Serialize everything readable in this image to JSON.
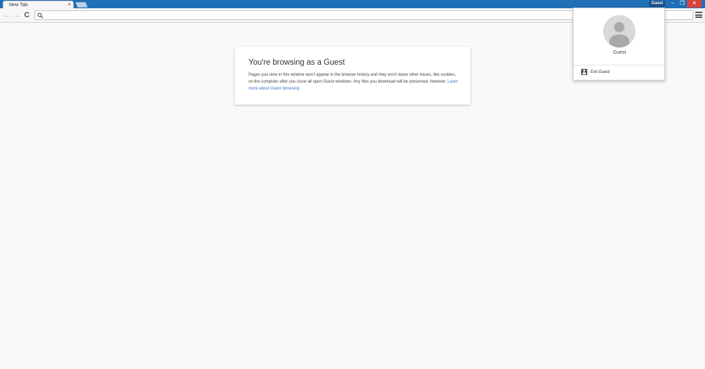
{
  "window": {
    "tab_title": "New Tab",
    "tab_close_glyph": "×",
    "profile_badge": "Guest",
    "minimize_glyph": "–",
    "maximize_glyph": "❐",
    "close_glyph": "✕",
    "accent_color": "#1f6fb6"
  },
  "toolbar": {
    "back_glyph": "←",
    "forward_glyph": "→",
    "reload_glyph": "C",
    "omnibox_value": "",
    "icons": [
      "back-arrow-icon",
      "forward-arrow-icon",
      "reload-icon",
      "search-icon",
      "hamburger-menu-icon"
    ]
  },
  "guest_card": {
    "title": "You're browsing as a Guest",
    "body": "Pages you view in this window won't appear in the browser history and they won't leave other traces, like cookies, on the computer after you close all open Guest windows. Any files you download will be preserved, however.",
    "link": "Learn more about Guest browsing",
    "link_color": "#3b6fc9"
  },
  "profile_popup": {
    "name": "Guest",
    "exit_label": "Exit Guest",
    "icons": [
      "avatar-icon",
      "exit-guest-icon"
    ]
  }
}
